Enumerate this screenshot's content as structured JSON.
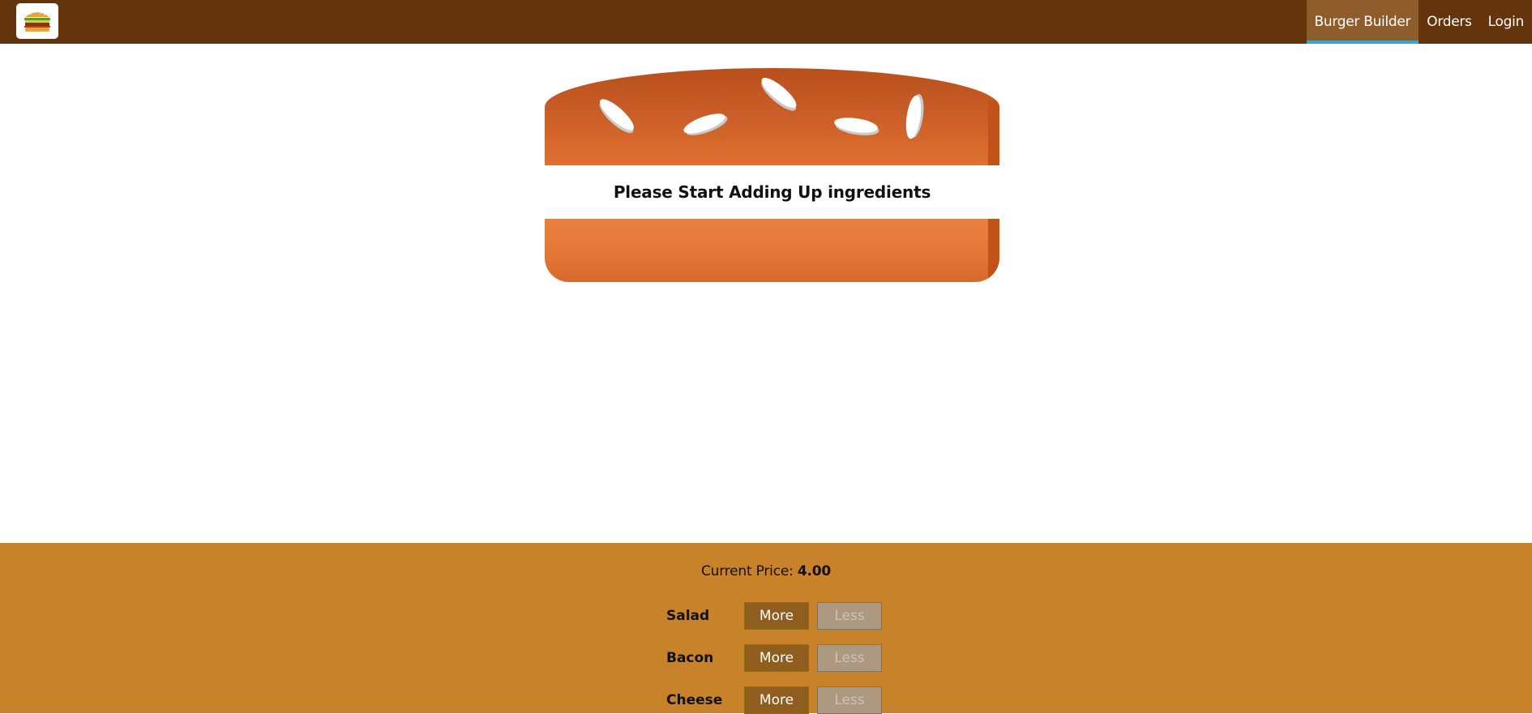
{
  "toolbar": {
    "logo_alt": "burger-logo",
    "nav": [
      {
        "label": "Burger Builder",
        "active": true
      },
      {
        "label": "Orders",
        "active": false
      },
      {
        "label": "Login",
        "active": false
      }
    ]
  },
  "burger": {
    "message": "Please Start Adding Up ingredients"
  },
  "controls": {
    "price_label": "Current Price:",
    "price_value": "4.00",
    "ingredients": [
      {
        "label": "Salad",
        "more": "More",
        "less": "Less"
      },
      {
        "label": "Bacon",
        "more": "More",
        "less": "Less"
      },
      {
        "label": "Cheese",
        "more": "More",
        "less": "Less"
      }
    ]
  },
  "colors": {
    "toolbar_bg": "#64340d",
    "nav_active_bg": "#8f5c2c",
    "nav_active_underline": "#40a4c8",
    "controls_bg": "#c8832a",
    "more_button_bg": "#8f5e1e",
    "less_button_bg_disabled": "#ac9980"
  }
}
